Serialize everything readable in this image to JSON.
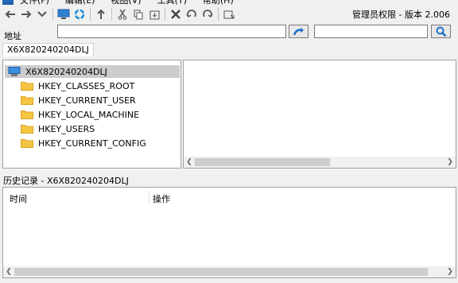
{
  "menubar": {
    "items": [
      "文件(F)",
      "编辑(E)",
      "视图(V)",
      "工具(T)",
      "帮助(H)"
    ]
  },
  "toolbar": {
    "buttons": [
      {
        "name": "back-icon"
      },
      {
        "name": "forward-icon"
      },
      {
        "name": "dropdown-icon"
      },
      {
        "name": "computer-icon"
      },
      {
        "name": "refresh-icon"
      },
      {
        "name": "up-icon"
      },
      {
        "name": "cut-icon"
      },
      {
        "name": "copy-icon"
      },
      {
        "name": "paste-icon"
      },
      {
        "name": "delete-icon"
      },
      {
        "name": "undo-icon"
      },
      {
        "name": "redo-icon"
      },
      {
        "name": "new-window-icon"
      }
    ],
    "admin_label": "管理员权限 - 版本 2.006"
  },
  "address": {
    "label": "地址",
    "value": "",
    "search_value": ""
  },
  "tab": {
    "label": "X6X820240204DLJ"
  },
  "tree": {
    "root": "X6X820240204DLJ",
    "items": [
      "HKEY_CLASSES_ROOT",
      "HKEY_CURRENT_USER",
      "HKEY_LOCAL_MACHINE",
      "HKEY_USERS",
      "HKEY_CURRENT_CONFIG"
    ]
  },
  "history": {
    "label": "历史记录 - X6X820240204DLJ",
    "columns": [
      "时间",
      "操作"
    ]
  },
  "colors": {
    "selection": "#cccccc",
    "folder": "#f5c542",
    "accent": "#1b6fc8"
  }
}
